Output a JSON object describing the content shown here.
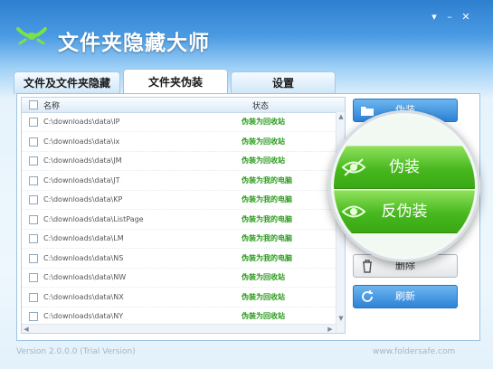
{
  "window": {
    "title": "文件夹隐藏大师"
  },
  "tabs": [
    {
      "label": "文件及文件夹隐藏"
    },
    {
      "label": "文件夹伪装",
      "active": true
    },
    {
      "label": "设置"
    }
  ],
  "list": {
    "columns": {
      "name": "名称",
      "status": "状态"
    },
    "rows": [
      {
        "path": "C:\\downloads\\data\\IP",
        "status": "伪装为回收站"
      },
      {
        "path": "C:\\downloads\\data\\ix",
        "status": "伪装为回收站"
      },
      {
        "path": "C:\\downloads\\data\\JM",
        "status": "伪装为回收站"
      },
      {
        "path": "C:\\downloads\\data\\JT",
        "status": "伪装为我的电脑"
      },
      {
        "path": "C:\\downloads\\data\\KP",
        "status": "伪装为我的电脑"
      },
      {
        "path": "C:\\downloads\\data\\ListPage",
        "status": "伪装为我的电脑"
      },
      {
        "path": "C:\\downloads\\data\\LM",
        "status": "伪装为我的电脑"
      },
      {
        "path": "C:\\downloads\\data\\NS",
        "status": "伪装为我的电脑"
      },
      {
        "path": "C:\\downloads\\data\\NW",
        "status": "伪装为回收站"
      },
      {
        "path": "C:\\downloads\\data\\NX",
        "status": "伪装为回收站"
      },
      {
        "path": "C:\\downloads\\data\\NY",
        "status": "伪装为回收站"
      }
    ]
  },
  "actions": {
    "disguise": "伪装",
    "undisguise": "反伪装",
    "delete": "删除",
    "refresh": "刷新"
  },
  "footer": {
    "version": "Version 2.0.0.0 (Trial Version)",
    "site": "www.foldersafe.com"
  },
  "colors": {
    "accent": "#2d83d6",
    "green": "#47b81f",
    "status_text": "#2a9b1c"
  }
}
